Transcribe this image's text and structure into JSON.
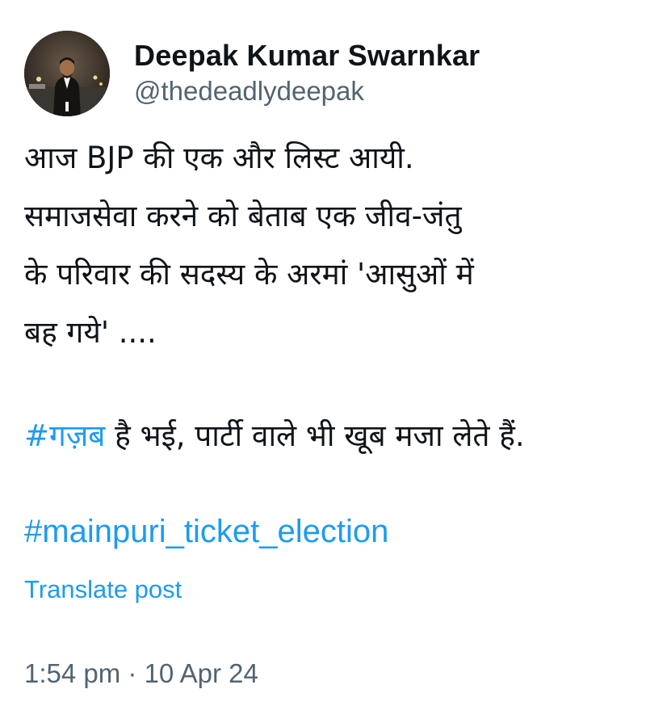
{
  "author": {
    "display_name": "Deepak Kumar Swarnkar",
    "handle": "@thedeadlydeepak"
  },
  "post": {
    "body_lines": [
      "आज BJP की एक और लिस्ट आयी.",
      "समाजसेवा करने को बेताब एक जीव-जंतु",
      "के परिवार की सदस्य के अरमां 'आसुओं में",
      "बह गये' ...."
    ],
    "hashtag_gazab": "#गज़ब",
    "gazab_rest": " है भई, पार्टी वाले भी खूब मजा लेते हैं.",
    "hashtag_election": "#mainpuri_ticket_election",
    "translate_label": "Translate post",
    "timestamp": "1:54 pm · 10 Apr 24"
  },
  "colors": {
    "link": "#1d9bf0",
    "text": "#0f1419",
    "secondary": "#536471"
  },
  "icons": {
    "avatar": "profile-photo"
  }
}
